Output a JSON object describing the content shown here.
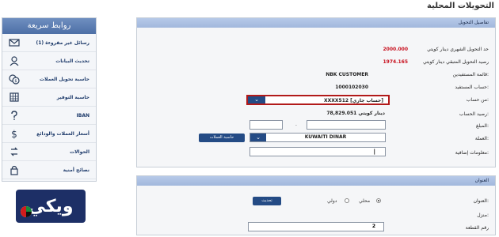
{
  "page": {
    "title": "التحويلات المحلية"
  },
  "sidebar": {
    "header": "روابط سريعة",
    "items": [
      {
        "label": "رسائل غير مقروءة (1)",
        "icon": "envelope-icon"
      },
      {
        "label": "تحديث البيانات",
        "icon": "user-icon"
      },
      {
        "label": "حاسبة تحويل العملات",
        "icon": "currency-calculator-icon"
      },
      {
        "label": "حاسبة التوفير",
        "icon": "calculator-icon"
      },
      {
        "label": "IBAN",
        "icon": "question-icon"
      },
      {
        "label": "أسعار العملات والودائع",
        "icon": "dollar-icon"
      },
      {
        "label": "الحوالات",
        "icon": "transfer-icon"
      },
      {
        "label": "نصائح أمنية",
        "icon": "lock-icon"
      }
    ]
  },
  "details": {
    "header": "تفاصيل التحويل",
    "monthly_limit_label": "حد التحويل الشهري دينار كويتي",
    "monthly_limit_value": "2000.000",
    "remaining_label": "رصيد التحويل المتبقي دينار كويتي",
    "remaining_value": "1974.165",
    "beneficiary_list_label": "قائمة المستفيدين:",
    "beneficiary_list_value": "NBK CUSTOMER",
    "beneficiary_account_label": "حساب المستفيد:",
    "beneficiary_account_value": "1000102030",
    "from_account_label": "من حساب:",
    "from_account_value": "XXXX512 [حساب جاري]",
    "balance_label": "رصيد الحساب:",
    "balance_value": "78,829.051 دينار كويتي",
    "amount_label": "المبلغ:",
    "amount_separator": ".",
    "currency_label": "العملة:",
    "currency_value": "KUWAITI DINAR",
    "calc_button": "حاسبة العملات",
    "additional_info_label": "معلومات إضافية:",
    "additional_info_value": "|"
  },
  "address": {
    "header": "العنوان",
    "address_label": "العنوان:",
    "local_label": "محلي",
    "intl_label": "دولي",
    "update_button": "تحديث",
    "home_label": "منزل:",
    "area_label": "رقم القطعة",
    "area_value": "2"
  },
  "logo": {
    "text": "ويكي"
  }
}
